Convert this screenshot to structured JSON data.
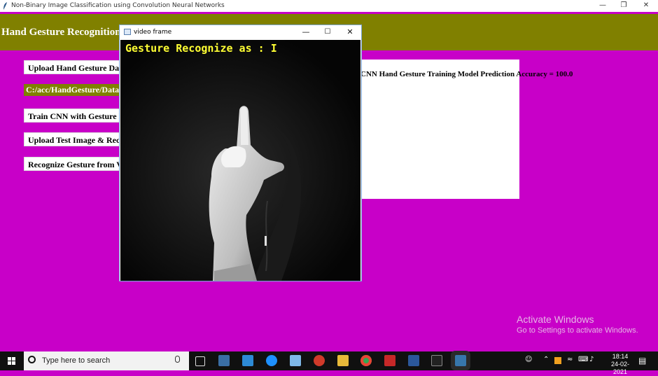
{
  "app": {
    "window_title": "Non-Binary Image Classification using Convolution Neural Networks",
    "banner_title": "Hand Gesture Recognition using Convolution Neural Networks",
    "colors": {
      "background": "#c800c8",
      "banner": "#808000",
      "button": "#ffffff",
      "overlay_text": "#ffff33"
    }
  },
  "buttons": {
    "upload_dataset": "Upload Hand Gesture Dataset",
    "train_cnn": "Train CNN with Gesture Images",
    "upload_test": "Upload Test Image & Recognize Gesture",
    "recognize_video": "Recognize Gesture from Video"
  },
  "dataset_path": "C:/acc/HandGesture/Dataset",
  "output_text": "CNN Hand Gesture Training Model Prediction Accuracy = 100.0",
  "video_window": {
    "title": "video frame",
    "overlay_text": "Gesture Recognize as : I"
  },
  "watermark": {
    "line1": "Activate Windows",
    "line2": "Go to Settings to activate Windows."
  },
  "taskbar": {
    "search_placeholder": "Type here to search",
    "time": "18:14",
    "date": "24-02-2021",
    "icons": [
      "windows-start-icon",
      "task-view-icon",
      "store-icon",
      "mail-icon",
      "edge-icon",
      "files-icon",
      "antivirus-icon",
      "explorer-icon",
      "chrome-icon",
      "acrobat-icon",
      "word-icon",
      "terminal-icon",
      "python-icon"
    ]
  }
}
